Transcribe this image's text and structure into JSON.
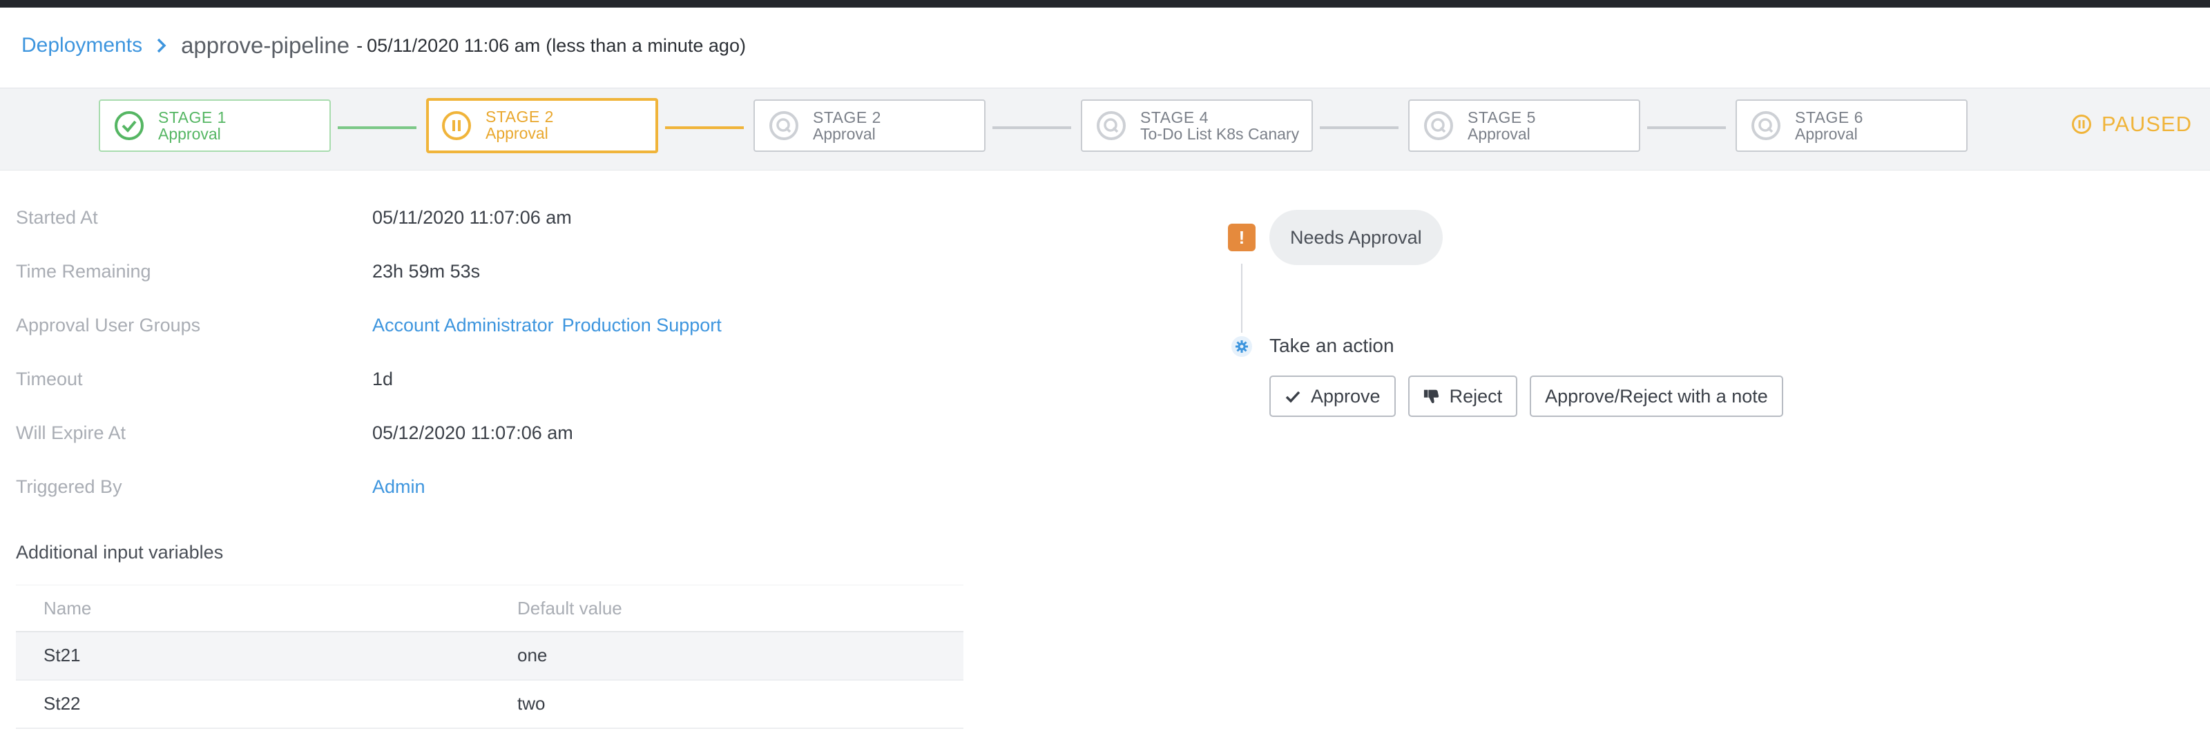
{
  "breadcrumb": {
    "root": "Deployments",
    "pipeline": "approve-pipeline",
    "separator": "-",
    "timestamp": "05/11/2020 11:06 am",
    "relative": "(less than a minute ago)"
  },
  "stages": [
    {
      "name": "STAGE 1",
      "sub": "Approval",
      "status": "done"
    },
    {
      "name": "STAGE 2",
      "sub": "Approval",
      "status": "running"
    },
    {
      "name": "STAGE 2",
      "sub": "Approval",
      "status": "queued"
    },
    {
      "name": "STAGE 4",
      "sub": "To-Do List K8s Canary",
      "status": "queued"
    },
    {
      "name": "STAGE 5",
      "sub": "Approval",
      "status": "queued"
    },
    {
      "name": "STAGE 6",
      "sub": "Approval",
      "status": "queued"
    }
  ],
  "status_label": "PAUSED",
  "details": {
    "started_at": {
      "label": "Started At",
      "value": "05/11/2020 11:07:06 am"
    },
    "time_remaining": {
      "label": "Time Remaining",
      "value": "23h 59m 53s"
    },
    "approval_groups": {
      "label": "Approval User Groups",
      "values": [
        "Account Administrator",
        "Production Support"
      ]
    },
    "timeout": {
      "label": "Timeout",
      "value": "1d"
    },
    "will_expire_at": {
      "label": "Will Expire At",
      "value": "05/12/2020 11:07:06 am"
    },
    "triggered_by": {
      "label": "Triggered By",
      "value": "Admin"
    }
  },
  "variables": {
    "title": "Additional input variables",
    "columns": [
      "Name",
      "Default value"
    ],
    "rows": [
      {
        "name": "St21",
        "value": "one"
      },
      {
        "name": "St22",
        "value": "two"
      }
    ]
  },
  "approval": {
    "needs_label": "Needs Approval",
    "take_action": "Take an action",
    "approve": "Approve",
    "reject": "Reject",
    "note": "Approve/Reject with a note"
  },
  "colors": {
    "accent": "#3d95de",
    "success": "#55b663",
    "paused": "#f0b43a",
    "warning": "#e58a3d"
  }
}
